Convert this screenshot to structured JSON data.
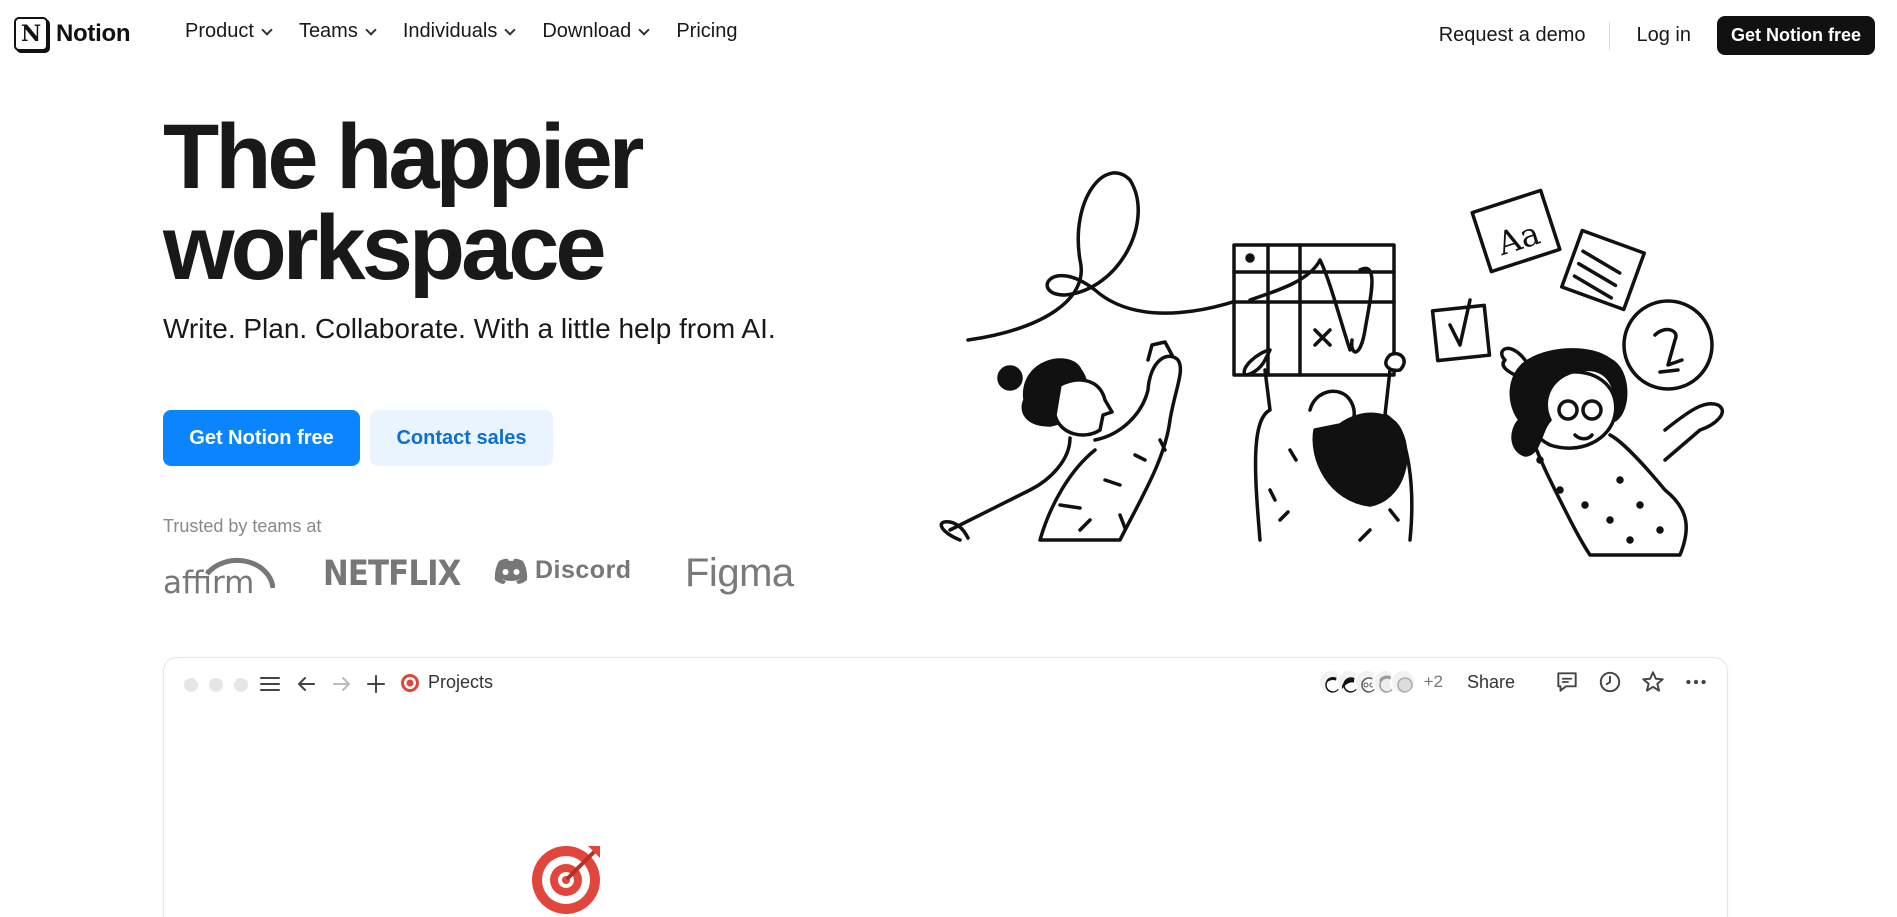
{
  "brand": {
    "name": "Notion",
    "logo_letter": "N"
  },
  "nav": {
    "items": [
      {
        "label": "Product",
        "has_menu": true
      },
      {
        "label": "Teams",
        "has_menu": true
      },
      {
        "label": "Individuals",
        "has_menu": true
      },
      {
        "label": "Download",
        "has_menu": true
      },
      {
        "label": "Pricing",
        "has_menu": false
      }
    ],
    "request_demo": "Request a demo",
    "login": "Log in",
    "cta": "Get Notion free"
  },
  "hero": {
    "title_line1": "The happier",
    "title_line2": "workspace",
    "subtitle": "Write. Plan. Collaborate. With a little help from AI.",
    "primary_button": "Get Notion free",
    "secondary_button": "Contact sales",
    "trusted_label": "Trusted by teams at",
    "logos": {
      "affirm": "affirm",
      "netflix": "NETFLIX",
      "discord": "Discord",
      "figma": "Figma"
    }
  },
  "app_window": {
    "breadcrumb": "Projects",
    "extra_collaborators": "+2",
    "share_label": "Share"
  },
  "colors": {
    "primary": "#0a85ff",
    "secondary_bg": "#eaf4fe",
    "secondary_text": "#0b6fd6",
    "dark_cta": "#111111",
    "target_red": "#e0463c"
  },
  "icons": [
    "menu-icon",
    "back-arrow-icon",
    "forward-arrow-icon",
    "plus-icon",
    "target-icon",
    "comment-icon",
    "clock-icon",
    "star-icon",
    "more-icon"
  ]
}
